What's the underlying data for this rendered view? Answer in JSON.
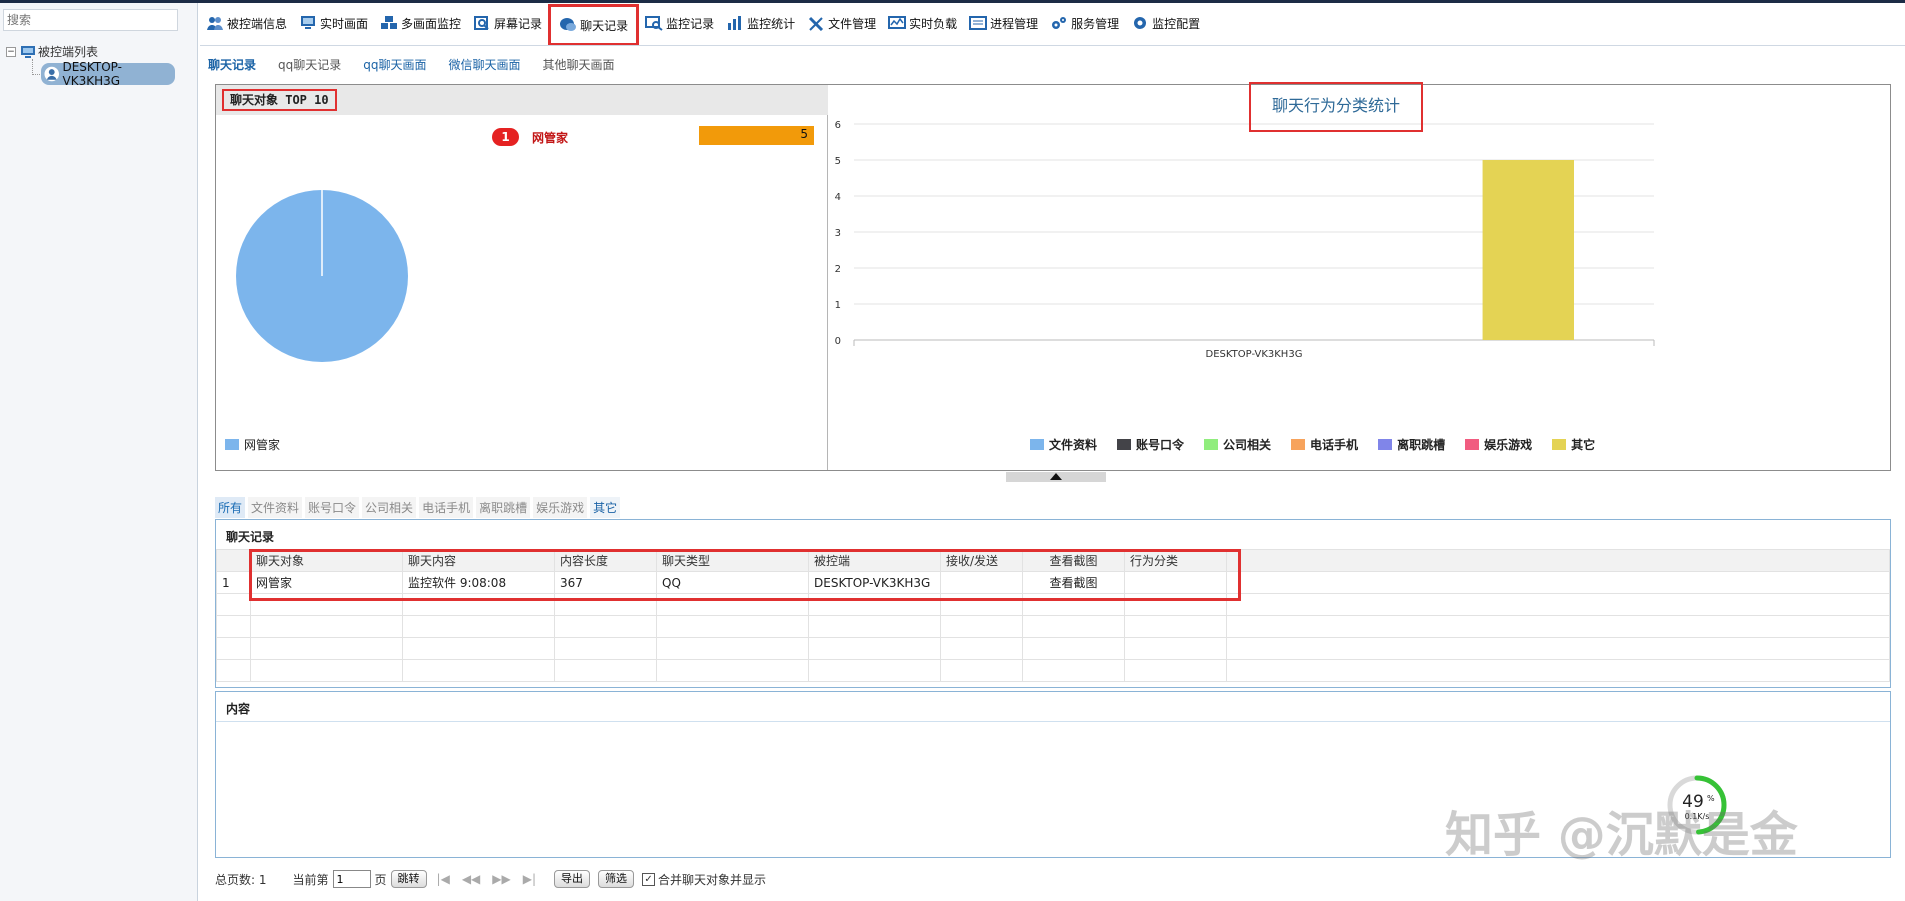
{
  "sidebar": {
    "search_placeholder": "搜索",
    "tree_root": "被控端列表",
    "tree_child": "DESKTOP-VK3KH3G"
  },
  "toolbar": {
    "items": [
      {
        "label": "被控端信息",
        "icon": "users-icon"
      },
      {
        "label": "实时画面",
        "icon": "monitor-icon"
      },
      {
        "label": "多画面监控",
        "icon": "multi-screen-icon"
      },
      {
        "label": "屏幕记录",
        "icon": "screen-record-icon"
      },
      {
        "label": "聊天记录",
        "icon": "chat-icon"
      },
      {
        "label": "监控记录",
        "icon": "monitor-log-icon"
      },
      {
        "label": "监控统计",
        "icon": "stats-icon"
      },
      {
        "label": "文件管理",
        "icon": "tools-icon"
      },
      {
        "label": "实时负载",
        "icon": "load-icon"
      },
      {
        "label": "进程管理",
        "icon": "process-icon"
      },
      {
        "label": "服务管理",
        "icon": "service-icon"
      },
      {
        "label": "监控配置",
        "icon": "gear-icon"
      }
    ],
    "active_index": 4
  },
  "subtabs": [
    "聊天记录",
    "qq聊天记录",
    "qq聊天画面",
    "微信聊天画面",
    "其他聊天画面"
  ],
  "top10": {
    "title": "聊天对象 TOP 10",
    "rank": "1",
    "name": "网管家",
    "value": "5",
    "legend": "网管家"
  },
  "chart_data": {
    "type": "bar",
    "title": "聊天行为分类统计",
    "categories": [
      "DESKTOP-VK3KH3G"
    ],
    "ylim": [
      0,
      6
    ],
    "yticks": [
      "0",
      "1",
      "2",
      "3",
      "4",
      "5",
      "6"
    ],
    "series": [
      {
        "name": "文件资料",
        "color": "#7cb5ec",
        "values": [
          0
        ]
      },
      {
        "name": "账号口令",
        "color": "#434348",
        "values": [
          0
        ]
      },
      {
        "name": "公司相关",
        "color": "#90ed7d",
        "values": [
          0
        ]
      },
      {
        "name": "电话手机",
        "color": "#f7a35c",
        "values": [
          0
        ]
      },
      {
        "name": "离职跳槽",
        "color": "#8085e9",
        "values": [
          0
        ]
      },
      {
        "name": "娱乐游戏",
        "color": "#f15c80",
        "values": [
          0
        ]
      },
      {
        "name": "其它",
        "color": "#e4d354",
        "values": [
          5
        ]
      }
    ],
    "grid": true,
    "legend": "bottom"
  },
  "pie": {
    "color": "#7cb5ec"
  },
  "filters": [
    "所有",
    "文件资料",
    "账号口令",
    "公司相关",
    "电话手机",
    "离职跳槽",
    "娱乐游戏",
    "其它"
  ],
  "grid": {
    "title": "聊天记录",
    "columns": [
      "聊天对象",
      "聊天内容",
      "内容长度",
      "聊天类型",
      "被控端",
      "接收/发送",
      "查看截图",
      "行为分类"
    ],
    "rows": [
      {
        "num": "1",
        "cells": [
          "网管家",
          "监控软件  9:08:08",
          "367",
          "QQ",
          "DESKTOP-VK3KH3G",
          "",
          "查看截图",
          ""
        ]
      }
    ]
  },
  "content": {
    "title": "内容"
  },
  "pager": {
    "total_label": "总页数: 1",
    "current_label": "当前第",
    "page_value": "1",
    "page_suffix": "页",
    "jump": "跳转",
    "export": "导出",
    "filter": "筛选",
    "merge_label": "合并聊天对象并显示",
    "nav_first": "|◀",
    "nav_prev": "◀◀",
    "nav_next": "▶▶",
    "nav_last": "▶|"
  },
  "gauge": {
    "value": "49",
    "unit": "%",
    "sub": "0.1K/s"
  },
  "watermark": "知乎 @沉默是金"
}
